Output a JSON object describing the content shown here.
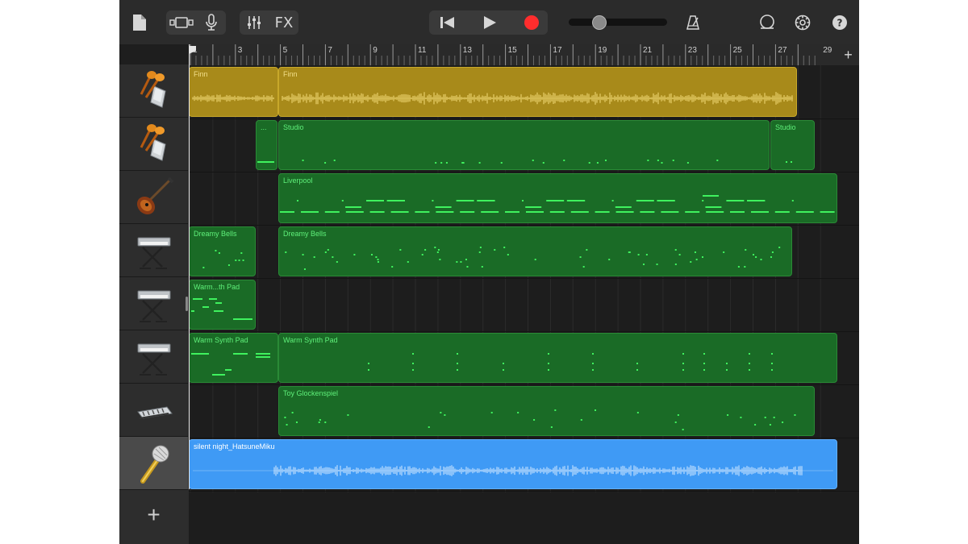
{
  "toolbar": {
    "fx_label": "FX",
    "colors": {
      "record": "#ff2d2d",
      "icon": "#d6d6d6"
    },
    "icons": [
      "document-icon",
      "view-toggle-icon",
      "microphone-icon",
      "mixer-icon",
      "fx-button",
      "rewind-icon",
      "play-icon",
      "record-icon",
      "volume-slider",
      "metronome-icon",
      "loop-icon",
      "settings-icon",
      "help-icon"
    ],
    "volume_level": 0.3
  },
  "ruler": {
    "bars": [
      "1",
      "3",
      "5",
      "7",
      "9",
      "11",
      "13",
      "15",
      "17",
      "19",
      "21",
      "23",
      "25",
      "27",
      "29"
    ],
    "add_section_label": "+"
  },
  "tracks": [
    {
      "id": "t1",
      "instrument": "shaker-icon"
    },
    {
      "id": "t2",
      "instrument": "shaker-icon"
    },
    {
      "id": "t3",
      "instrument": "bass-guitar-icon"
    },
    {
      "id": "t4",
      "instrument": "keyboard-stand-icon"
    },
    {
      "id": "t5",
      "instrument": "keyboard-stand-icon"
    },
    {
      "id": "t6",
      "instrument": "keyboard-stand-icon"
    },
    {
      "id": "t7",
      "instrument": "glockenspiel-icon"
    },
    {
      "id": "t8",
      "instrument": "microphone-vocal-icon",
      "selected": true
    }
  ],
  "add_track_label": "+",
  "regions": {
    "t1": [
      {
        "label": "Finn",
        "kind": "audio-yellow"
      },
      {
        "label": "Finn",
        "kind": "audio-yellow"
      }
    ],
    "t2": [
      {
        "label": "...",
        "kind": "midi"
      },
      {
        "label": "Studio",
        "kind": "midi"
      },
      {
        "label": "Studio",
        "kind": "midi"
      }
    ],
    "t3": [
      {
        "label": "Liverpool",
        "kind": "midi"
      }
    ],
    "t4": [
      {
        "label": "Dreamy Bells",
        "kind": "midi"
      },
      {
        "label": "Dreamy Bells",
        "kind": "midi"
      }
    ],
    "t5": [
      {
        "label": "Warm...th Pad",
        "kind": "midi"
      }
    ],
    "t6": [
      {
        "label": "Warm Synth Pad",
        "kind": "midi"
      },
      {
        "label": "Warm Synth Pad",
        "kind": "midi"
      }
    ],
    "t7": [
      {
        "label": "Toy Glockenspiel",
        "kind": "midi"
      }
    ],
    "t8": [
      {
        "label": "silent night_HatsuneMiku",
        "kind": "audio-blue"
      }
    ]
  }
}
